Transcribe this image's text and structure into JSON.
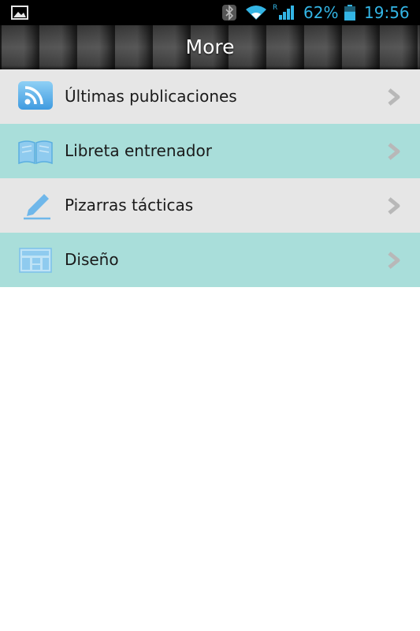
{
  "status_bar": {
    "battery_percent": "62%",
    "time": "19:56",
    "icons": [
      "gallery-icon",
      "bluetooth-icon",
      "wifi-icon",
      "signal-icon",
      "battery-icon"
    ],
    "accent_color": "#33b5e5",
    "battery_level": 0.62
  },
  "header": {
    "title": "More"
  },
  "menu": {
    "items": [
      {
        "label": "Últimas publicaciones",
        "icon": "rss-icon",
        "background": "#e6e6e6"
      },
      {
        "label": "Libreta entrenador",
        "icon": "book-icon",
        "background": "#a9deda"
      },
      {
        "label": "Pizarras tácticas",
        "icon": "pencil-icon",
        "background": "#e6e6e6"
      },
      {
        "label": "Diseño",
        "icon": "layout-grid-icon",
        "background": "#a9deda"
      }
    ],
    "chevron_icon": "chevron-right-icon"
  }
}
